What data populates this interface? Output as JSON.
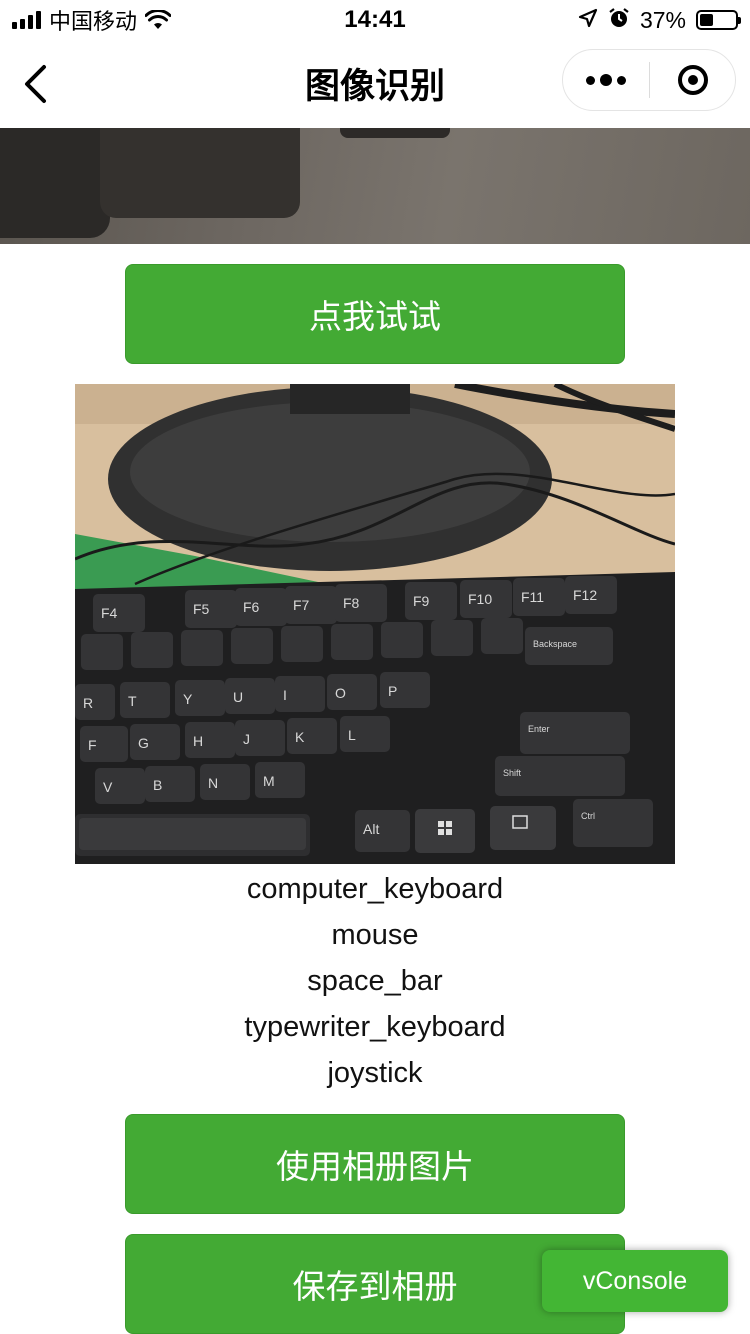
{
  "status_bar": {
    "carrier": "中国移动",
    "time": "14:41",
    "battery_percent": "37%",
    "battery_level": 0.37,
    "icons": [
      "signal-icon",
      "wifi-icon",
      "location-icon",
      "alarm-icon",
      "battery-icon"
    ]
  },
  "nav": {
    "title": "图像识别",
    "back_icon": "chevron-left-icon",
    "more_icon": "more-dots-icon",
    "close_icon": "target-icon"
  },
  "buttons": {
    "try_label": "点我试试",
    "album_label": "使用相册图片",
    "save_label": "保存到相册"
  },
  "results": [
    "computer_keyboard",
    "mouse",
    "space_bar",
    "typewriter_keyboard",
    "joystick"
  ],
  "photo": {
    "key_labels": [
      "F4",
      "F5",
      "F6",
      "F7",
      "F8",
      "F9",
      "F10",
      "F11",
      "F12",
      "Backspace",
      "Enter",
      "Shift",
      "Alt",
      "Ctrl",
      "R",
      "T",
      "Y",
      "U",
      "I",
      "O",
      "P",
      "F",
      "G",
      "H",
      "J",
      "K",
      "L",
      "V",
      "B",
      "N",
      "M"
    ]
  },
  "vconsole": {
    "label": "vConsole"
  },
  "colors": {
    "button_green": "#43aa34",
    "vconsole_green": "#43b634"
  }
}
